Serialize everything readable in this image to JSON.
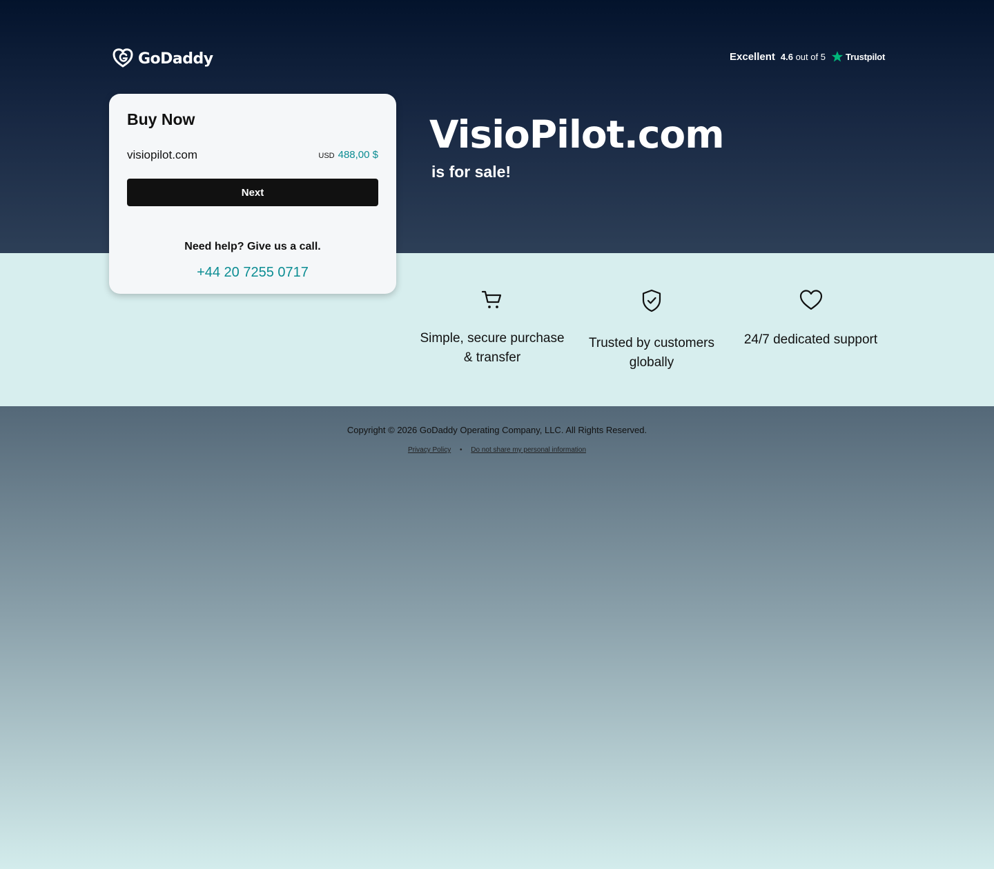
{
  "header": {
    "logo_text": "GoDaddy",
    "trustpilot": {
      "rating_word": "Excellent",
      "score": "4.6",
      "score_suffix": "out of 5",
      "brand": "Trustpilot",
      "star_color": "#00b67a"
    }
  },
  "buy_card": {
    "title": "Buy Now",
    "domain": "visiopilot.com",
    "currency": "USD",
    "price": "488,00 $",
    "next_label": "Next",
    "help_text": "Need help? Give us a call.",
    "phone": "+44 20 7255 0717"
  },
  "hero": {
    "domain_title": "VisioPilot.com",
    "subtitle": "is for sale!"
  },
  "features": [
    {
      "icon": "cart-icon",
      "text": "Simple, secure purchase & transfer"
    },
    {
      "icon": "shield-check-icon",
      "text": "Trusted by customers globally"
    },
    {
      "icon": "heart-icon",
      "text": "24/7 dedicated support"
    }
  ],
  "footer": {
    "copyright": "Copyright © 2026 GoDaddy Operating Company, LLC. All Rights Reserved.",
    "links": [
      "Privacy Policy",
      "Do not share my personal information"
    ],
    "separator": "•"
  },
  "colors": {
    "accent": "#0c8d93",
    "hero_top": "#03132c",
    "hero_bottom": "#2d3f57",
    "band": "#d7eeee"
  }
}
